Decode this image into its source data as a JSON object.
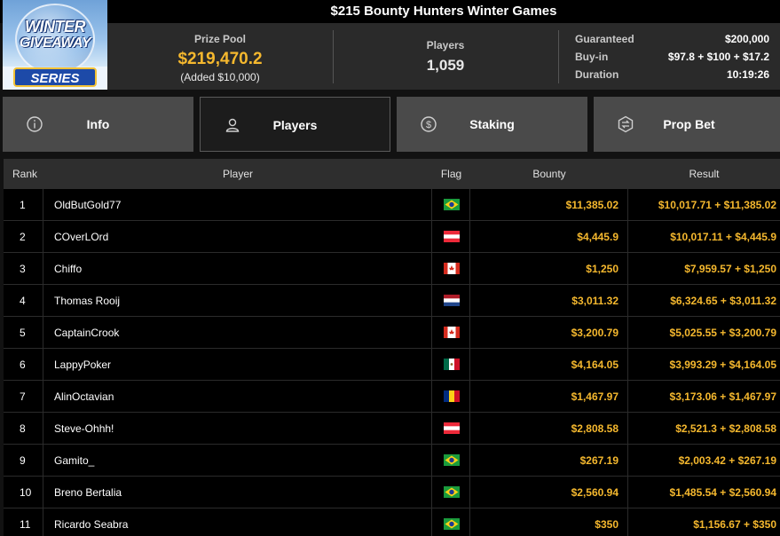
{
  "header": {
    "title": "$215 Bounty Hunters Winter Games",
    "logo": {
      "line1": "WINTER",
      "line2": "GIVEAWAY",
      "line3": "SERIES"
    }
  },
  "info": {
    "prize_pool_label": "Prize Pool",
    "prize_pool_value": "$219,470.2",
    "prize_pool_added": "(Added $10,000)",
    "players_label": "Players",
    "players_value": "1,059",
    "details": [
      {
        "label": "Guaranteed",
        "value": "$200,000"
      },
      {
        "label": "Buy-in",
        "value": "$97.8 + $100 + $17.2"
      },
      {
        "label": "Duration",
        "value": "10:19:26"
      }
    ]
  },
  "tabs": [
    {
      "label": "Info",
      "icon": "info-icon",
      "active": false
    },
    {
      "label": "Players",
      "icon": "user-icon",
      "active": true
    },
    {
      "label": "Staking",
      "icon": "dollar-coin-icon",
      "active": false
    },
    {
      "label": "Prop Bet",
      "icon": "prop-bet-icon",
      "active": false
    }
  ],
  "table": {
    "columns": [
      "Rank",
      "Player",
      "Flag",
      "Bounty",
      "Result"
    ],
    "rows": [
      {
        "rank": "1",
        "player": "OldButGold77",
        "flag": "brazil-flag",
        "bounty": "$11,385.02",
        "result": "$10,017.71 + $11,385.02"
      },
      {
        "rank": "2",
        "player": "COverLOrd",
        "flag": "austria-flag",
        "bounty": "$4,445.9",
        "result": "$10,017.11 + $4,445.9"
      },
      {
        "rank": "3",
        "player": "Chiffo",
        "flag": "canada-flag",
        "bounty": "$1,250",
        "result": "$7,959.57 + $1,250"
      },
      {
        "rank": "4",
        "player": "Thomas Rooij",
        "flag": "netherlands-flag",
        "bounty": "$3,011.32",
        "result": "$6,324.65 + $3,011.32"
      },
      {
        "rank": "5",
        "player": "CaptainCrook",
        "flag": "canada-flag",
        "bounty": "$3,200.79",
        "result": "$5,025.55 + $3,200.79"
      },
      {
        "rank": "6",
        "player": "LappyPoker",
        "flag": "mexico-flag",
        "bounty": "$4,164.05",
        "result": "$3,993.29 + $4,164.05"
      },
      {
        "rank": "7",
        "player": "AlinOctavian",
        "flag": "romania-flag",
        "bounty": "$1,467.97",
        "result": "$3,173.06 + $1,467.97"
      },
      {
        "rank": "8",
        "player": "Steve-Ohhh!",
        "flag": "austria-flag",
        "bounty": "$2,808.58",
        "result": "$2,521.3 + $2,808.58"
      },
      {
        "rank": "9",
        "player": "Gamito_",
        "flag": "brazil-flag",
        "bounty": "$267.19",
        "result": "$2,003.42 + $267.19"
      },
      {
        "rank": "10",
        "player": "Breno Bertalia",
        "flag": "brazil-flag",
        "bounty": "$2,560.94",
        "result": "$1,485.54 + $2,560.94"
      },
      {
        "rank": "11",
        "player": "Ricardo Seabra",
        "flag": "brazil-flag",
        "bounty": "$350",
        "result": "$1,156.67 + $350"
      }
    ]
  },
  "colors": {
    "accent_gold": "#f5b82e",
    "background": "#000000",
    "panel": "#2a2a2a",
    "tab_inactive": "#4a4a4a"
  }
}
